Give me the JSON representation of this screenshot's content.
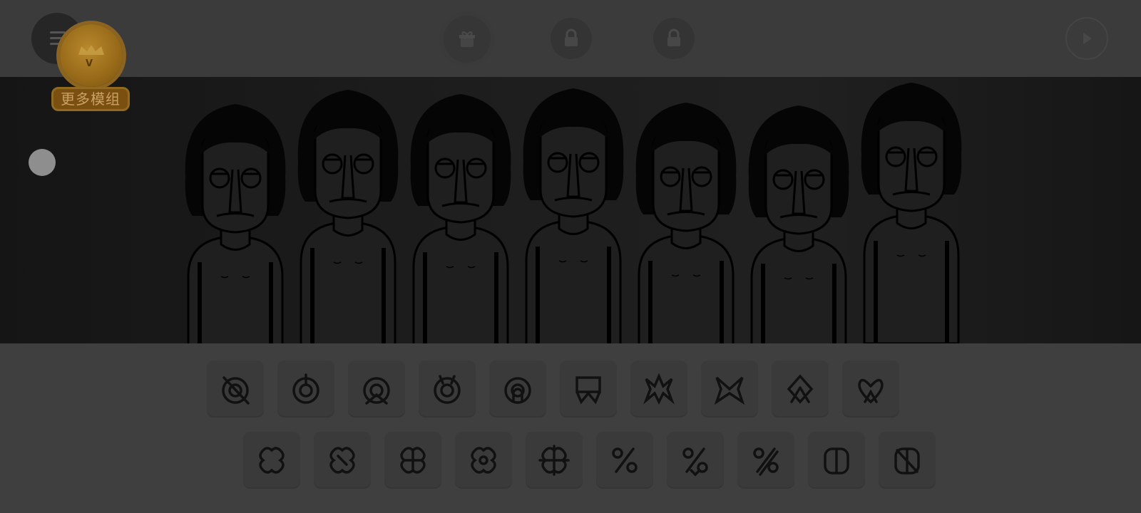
{
  "header": {
    "menu_icon": "hamburger-menu-icon",
    "bonus_icon": "bonus-gift-icon",
    "lock_icon": "lock-icon",
    "play_icon": "play-icon"
  },
  "more_mods": {
    "label": "更多模组",
    "badge_letter": "V",
    "icon": "crown-medal-icon"
  },
  "stage": {
    "character_count": 7,
    "toggle_icon": "toggle-knob-icon"
  },
  "sound_icons": {
    "row1": [
      "beat-1-icon",
      "beat-2-icon",
      "beat-3-icon",
      "beat-4-icon",
      "beat-5-icon",
      "effect-1-icon",
      "effect-2-icon",
      "effect-3-icon",
      "effect-4-icon",
      "effect-5-icon"
    ],
    "row2": [
      "melody-1-icon",
      "melody-2-icon",
      "melody-3-icon",
      "melody-4-icon",
      "melody-5-icon",
      "voice-1-icon",
      "voice-2-icon",
      "voice-3-icon",
      "voice-4-icon",
      "voice-5-icon"
    ]
  },
  "colors": {
    "overlay_bg": "#3f3f3f",
    "stage_bg": "#1b1b1b",
    "medal_gold": "#9a6c1a",
    "medal_text": "#c9a264",
    "line": "#000000"
  }
}
